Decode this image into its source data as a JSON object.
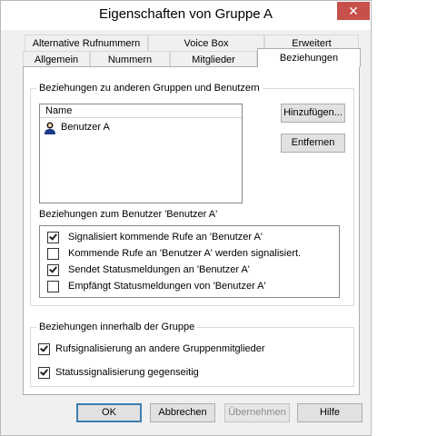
{
  "window": {
    "title": "Eigenschaften von Gruppe A",
    "close_symbol": "✕"
  },
  "tabs": {
    "row1": [
      {
        "label": "Alternative Rufnummern"
      },
      {
        "label": "Voice Box"
      },
      {
        "label": "Erweitert"
      }
    ],
    "row2": [
      {
        "label": "Allgemein"
      },
      {
        "label": "Nummern"
      },
      {
        "label": "Mitglieder"
      },
      {
        "label": "Beziehungen",
        "active": true
      }
    ]
  },
  "relations_group": {
    "label": "Beziehungen zu anderen Gruppen und Benutzern",
    "list": {
      "column_header": "Name",
      "items": [
        {
          "label": "Benutzer A",
          "icon": "user-icon"
        }
      ]
    },
    "add_button": "Hinzufügen...",
    "remove_button": "Entfernen",
    "user_relations_label": "Beziehungen zum Benutzer 'Benutzer A'",
    "user_relations": [
      {
        "label": "Signalisiert kommende Rufe an 'Benutzer A'",
        "checked": true
      },
      {
        "label": "Kommende Rufe an 'Benutzer A' werden signalisiert.",
        "checked": false
      },
      {
        "label": "Sendet Statusmeldungen an 'Benutzer A'",
        "checked": true
      },
      {
        "label": "Empfängt Statusmeldungen von 'Benutzer A'",
        "checked": false
      }
    ]
  },
  "group_relations": {
    "label": "Beziehungen innerhalb der Gruppe",
    "options": [
      {
        "label": "Rufsignalisierung an andere Gruppenmitglieder",
        "checked": true
      },
      {
        "label": "Statussignalisierung gegenseitig",
        "checked": true
      }
    ]
  },
  "footer": {
    "ok": "OK",
    "cancel": "Abbrechen",
    "apply": "Übernehmen",
    "help": "Hilfe"
  }
}
